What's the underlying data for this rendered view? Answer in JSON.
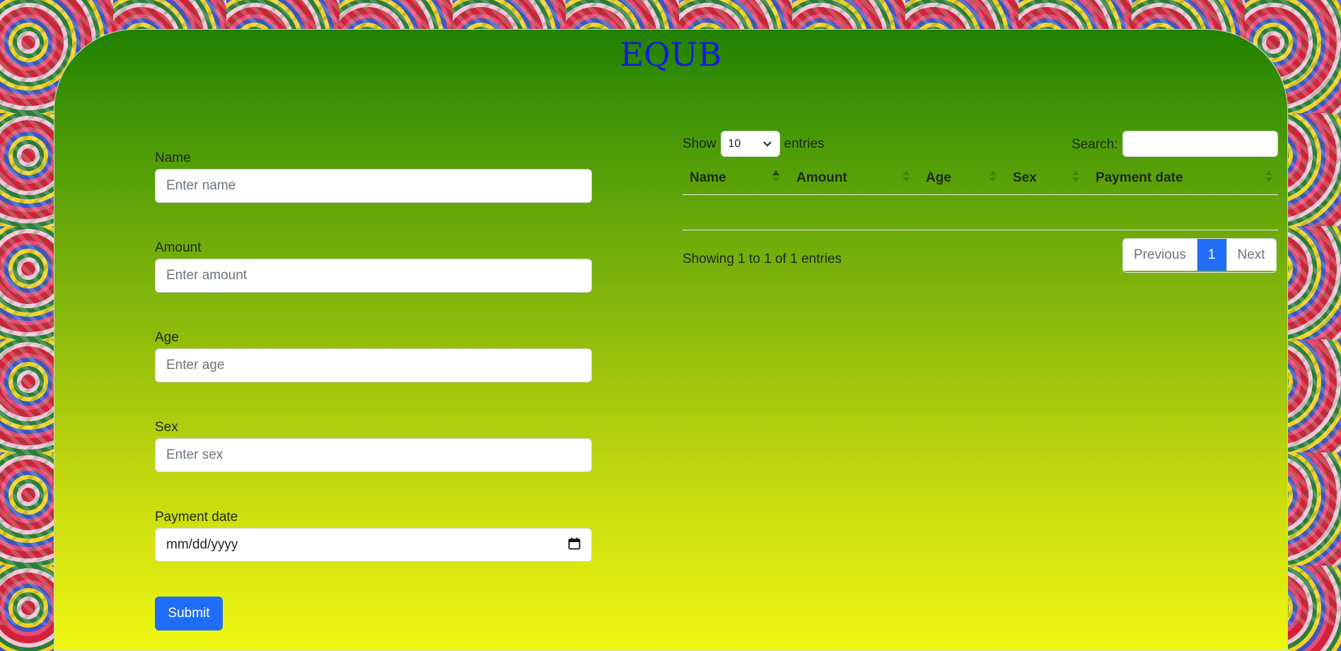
{
  "app": {
    "title": "EQUB"
  },
  "form": {
    "fields": [
      {
        "label": "Name",
        "placeholder": "Enter name"
      },
      {
        "label": "Amount",
        "placeholder": "Enter amount"
      },
      {
        "label": "Age",
        "placeholder": "Enter age"
      },
      {
        "label": "Sex",
        "placeholder": "Enter sex"
      },
      {
        "label": "Payment date",
        "value": "mm/dd/yyyy"
      }
    ],
    "submit_label": "Submit"
  },
  "table": {
    "show_label": "Show",
    "page_size": "10",
    "entries_label": "entries",
    "search_label": "Search:",
    "columns": [
      "Name",
      "Amount",
      "Age",
      "Sex",
      "Payment date"
    ],
    "info": "Showing 1 to 1 of 1 entries",
    "pagination": {
      "previous": "Previous",
      "current": "1",
      "next": "Next"
    }
  },
  "colors": {
    "title": "#1a1adf",
    "primary": "#1f6ef5",
    "gradient_top": "#208102",
    "gradient_bottom": "#f1f712"
  }
}
